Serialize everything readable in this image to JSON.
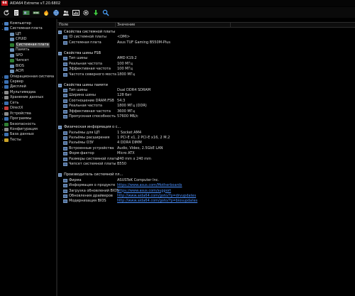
{
  "app": {
    "title": "AIDA64 Extreme v7.20.6802",
    "logo": "64"
  },
  "toolbar": {
    "icons": [
      "refresh-icon",
      "report-icon",
      "motherboard-icon",
      "memory-icon",
      "flame-icon",
      "network-icon",
      "users-icon",
      "benchmark-icon",
      "gear-icon",
      "download-icon",
      "search-icon"
    ]
  },
  "tree": [
    {
      "label": "Компьютер",
      "expander": "›",
      "color": "#4a7fc1"
    },
    {
      "label": "Системная плата",
      "expander": "⌄",
      "color": "#4a7fc1"
    },
    {
      "label": "ЦП",
      "color": "#6a8fb5"
    },
    {
      "label": "CPUID",
      "color": "#6a8fb5"
    },
    {
      "label": "Системная плата",
      "color": "#2e7d32",
      "selected": true
    },
    {
      "label": "Память",
      "color": "#6a8fb5"
    },
    {
      "label": "SPD",
      "color": "#6a8fb5"
    },
    {
      "label": "Чипсет",
      "color": "#2e7d32"
    },
    {
      "label": "BIOS",
      "color": "#6a8fb5"
    },
    {
      "label": "ACPI",
      "color": "#6a8fb5"
    },
    {
      "label": "Операционная система",
      "expander": "›",
      "color": "#3b6fb0"
    },
    {
      "label": "Сервер",
      "expander": "›",
      "color": "#3b6fb0"
    },
    {
      "label": "Дисплей",
      "expander": "›",
      "color": "#3b6fb0"
    },
    {
      "label": "Мультимедиа",
      "expander": "›",
      "color": "#8a8a8a"
    },
    {
      "label": "Хранение данных",
      "expander": "›",
      "color": "#8a8a8a"
    },
    {
      "label": "Сеть",
      "expander": "›",
      "color": "#3b6fb0"
    },
    {
      "label": "DirectX",
      "expander": "›",
      "color": "#c23b3b"
    },
    {
      "label": "Устройства",
      "expander": "›",
      "color": "#8a8a8a"
    },
    {
      "label": "Программы",
      "expander": "›",
      "color": "#3b6fb0"
    },
    {
      "label": "Безопасность",
      "expander": "›",
      "color": "#2e7d32"
    },
    {
      "label": "Конфигурация",
      "expander": "›",
      "color": "#8a8a8a"
    },
    {
      "label": "База данных",
      "expander": "›",
      "color": "#3b6fb0"
    },
    {
      "label": "Тесты",
      "expander": "›",
      "color": "#c9a227"
    }
  ],
  "columns": {
    "field": "Поле",
    "value": "Значение"
  },
  "rows": [
    {
      "type": "group",
      "label": "Свойства системной платы"
    },
    {
      "type": "item",
      "field": "ID системной платы",
      "value": "<DMI>"
    },
    {
      "type": "item",
      "field": "Системная плата",
      "value": "Asus TUF Gaming B550M-Plus"
    },
    {
      "type": "spacer"
    },
    {
      "type": "group",
      "label": "Свойства шины FSB"
    },
    {
      "type": "item",
      "field": "Тип шины",
      "value": "AMD K19.2"
    },
    {
      "type": "item",
      "field": "Реальная частота",
      "value": "100 МГц"
    },
    {
      "type": "item",
      "field": "Эффективная частота",
      "value": "100 МГц"
    },
    {
      "type": "item",
      "field": "Частота северного моста",
      "value": "1800 МГц"
    },
    {
      "type": "spacer"
    },
    {
      "type": "group",
      "label": "Свойства шины памяти"
    },
    {
      "type": "item",
      "field": "Тип шины",
      "value": "Dual DDR4 SDRAM"
    },
    {
      "type": "item",
      "field": "Ширина шины",
      "value": "128 бит"
    },
    {
      "type": "item",
      "field": "Соотношение DRAM:FSB",
      "value": "54:3"
    },
    {
      "type": "item",
      "field": "Реальная частота",
      "value": "1800 МГц (DDR)"
    },
    {
      "type": "item",
      "field": "Эффективная частота",
      "value": "3600 МГц"
    },
    {
      "type": "item",
      "field": "Пропускная способность",
      "value": "57600 МБ/с"
    },
    {
      "type": "spacer"
    },
    {
      "type": "group",
      "label": "Физическая информация о с..."
    },
    {
      "type": "item",
      "field": "Разъёмы для ЦП",
      "value": "1 Socket AM4"
    },
    {
      "type": "item",
      "field": "Разъёмы расширения",
      "value": "1 PCI-E x1, 2 PCI-E x16, 2 M.2"
    },
    {
      "type": "item",
      "field": "Разъёмы ОЗУ",
      "value": "4 DDR4 DIMM"
    },
    {
      "type": "item",
      "field": "Встроенные устройства",
      "value": "Audio, Video, 2.5GbE LAN"
    },
    {
      "type": "item",
      "field": "Форм-фактор",
      "value": "Micro ATX"
    },
    {
      "type": "item",
      "field": "Размеры системной платы",
      "value": "240 mm x 240 mm"
    },
    {
      "type": "item",
      "field": "Чипсет системной платы",
      "value": "B550"
    },
    {
      "type": "spacer"
    },
    {
      "type": "group",
      "label": "Производитель системной пл..."
    },
    {
      "type": "item",
      "field": "Фирма",
      "value": "ASUSTeK Computer Inc."
    },
    {
      "type": "item",
      "field": "Информация о продукте",
      "value": "https://www.asus.com/Motherboards",
      "link": true
    },
    {
      "type": "item",
      "field": "Загрузка обновлений BIOS",
      "value": "https://www.asus.com/support",
      "link": true
    },
    {
      "type": "item",
      "field": "Обновления драйверов",
      "value": "http://www.aida64.com/goto/?p=drvupdates",
      "link": true
    },
    {
      "type": "item",
      "field": "Модернизация BIOS",
      "value": "http://www.aida64.com/goto/?p=biosupdates",
      "link": true
    }
  ]
}
